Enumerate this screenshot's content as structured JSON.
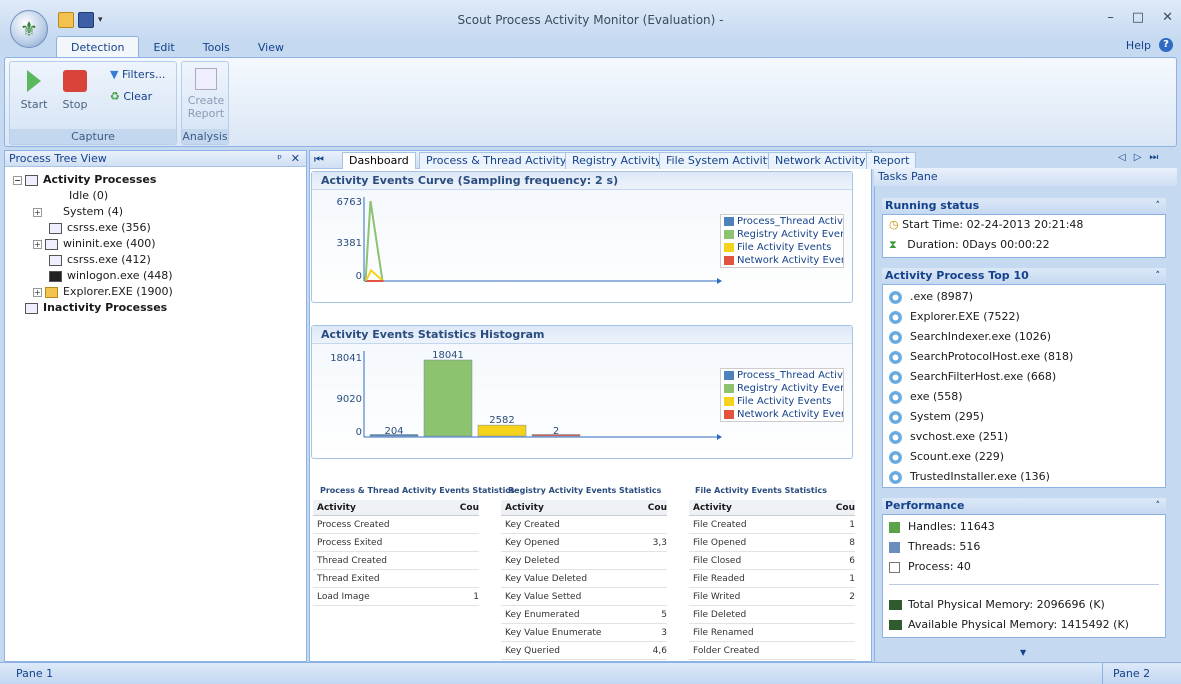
{
  "app": {
    "title": "Scout Process Activity Monitor (Evaluation) -"
  },
  "ribbon": {
    "tabs": [
      "Detection",
      "Edit",
      "Tools",
      "View"
    ],
    "help_label": "Help",
    "capture": {
      "start": "Start",
      "stop": "Stop",
      "filters": "Filters...",
      "clear": "Clear",
      "group": "Capture"
    },
    "analysis": {
      "create_report_1": "Create",
      "create_report_2": "Report",
      "group": "Analysis"
    }
  },
  "tree": {
    "title": "Process Tree View",
    "activity": "Activity Processes",
    "items": [
      "Idle (0)",
      "System (4)",
      "csrss.exe (356)",
      "wininit.exe (400)",
      "csrss.exe (412)",
      "winlogon.exe (448)",
      "Explorer.EXE (1900)"
    ],
    "inactivity": "Inactivity Processes"
  },
  "doc_tabs": [
    "Dashboard",
    "Process & Thread Activity",
    "Registry Activity",
    "File System Activity",
    "Network Activity",
    "Report"
  ],
  "legend": [
    "Process_Thread Activ",
    "Registry Activity Ever",
    "File Activity Events",
    "Network Activity Ever"
  ],
  "chart_colors": [
    "#4f81bd",
    "#8dc26f",
    "#f5d31d",
    "#e2543f"
  ],
  "chart_data": [
    {
      "type": "line",
      "title": "Activity Events Curve (Sampling frequency: 2 s)",
      "yticks": [
        "6763",
        "3381",
        "0"
      ],
      "ylim": [
        0,
        6763
      ],
      "series": [
        {
          "name": "Process_Thread Activ",
          "values": [
            0,
            0,
            0
          ]
        },
        {
          "name": "Registry Activity Ever",
          "values": [
            0,
            6763,
            0
          ]
        },
        {
          "name": "File Activity Events",
          "values": [
            0,
            900,
            0
          ]
        },
        {
          "name": "Network Activity Ever",
          "values": [
            0,
            0,
            0
          ]
        }
      ]
    },
    {
      "type": "bar",
      "title": "Activity Events Statistics Histogram",
      "yticks": [
        "18041",
        "9020",
        "0"
      ],
      "ylim": [
        0,
        18041
      ],
      "categories": [
        "Process_Thread Activ",
        "Registry Activity Ever",
        "File Activity Events",
        "Network Activity Ever"
      ],
      "values": [
        204,
        18041,
        2582,
        2
      ]
    }
  ],
  "stats": [
    {
      "title": "Process & Thread Activity Events Statistics",
      "col1": "Activity",
      "col2": "Cou",
      "rows": [
        [
          "Process Created",
          ""
        ],
        [
          "Process Exited",
          ""
        ],
        [
          "Thread Created",
          ""
        ],
        [
          "Thread Exited",
          ""
        ],
        [
          "Load Image",
          "1"
        ]
      ]
    },
    {
      "title": "Registry Activity Events Statistics",
      "col1": "Activity",
      "col2": "Cou",
      "rows": [
        [
          "Key Created",
          ""
        ],
        [
          "Key Opened",
          "3,3"
        ],
        [
          "Key Deleted",
          ""
        ],
        [
          "Key Value Deleted",
          ""
        ],
        [
          "Key Value Setted",
          ""
        ],
        [
          "Key Enumerated",
          "5"
        ],
        [
          "Key Value Enumerate",
          "3"
        ],
        [
          "Key Queried",
          "4,6"
        ]
      ]
    },
    {
      "title": "File Activity Events Statistics",
      "col1": "Activity",
      "col2": "Cou",
      "rows": [
        [
          "File Created",
          "1"
        ],
        [
          "File Opened",
          "8"
        ],
        [
          "File Closed",
          "6"
        ],
        [
          "File Readed",
          "1"
        ],
        [
          "File Writed",
          "2"
        ],
        [
          "File Deleted",
          ""
        ],
        [
          "File Renamed",
          ""
        ],
        [
          "Folder Created",
          ""
        ]
      ]
    }
  ],
  "tasks": {
    "title": "Tasks Pane",
    "running_status": "Running status",
    "start_time": "Start Time: 02-24-2013 20:21:48",
    "duration": "Duration: 0Days   00:00:22",
    "top10_title": "Activity Process Top 10",
    "top10": [
      ".exe (8987)",
      "Explorer.EXE (7522)",
      "SearchIndexer.exe (1026)",
      "SearchProtocolHost.exe (818)",
      "SearchFilterHost.exe (668)",
      "exe (558)",
      "System (295)",
      "svchost.exe (251)",
      "Scount.exe (229)",
      "TrustedInstaller.exe (136)"
    ],
    "perf_title": "Performance",
    "handles": "Handles: 11643",
    "threads": "Threads: 516",
    "process": "Process: 40",
    "total_mem": "Total Physical Memory: 2096696 (K)",
    "avail_mem": "Available Physical Memory: 1415492 (K)"
  },
  "status": {
    "left": "Pane 1",
    "right": "Pane 2"
  }
}
